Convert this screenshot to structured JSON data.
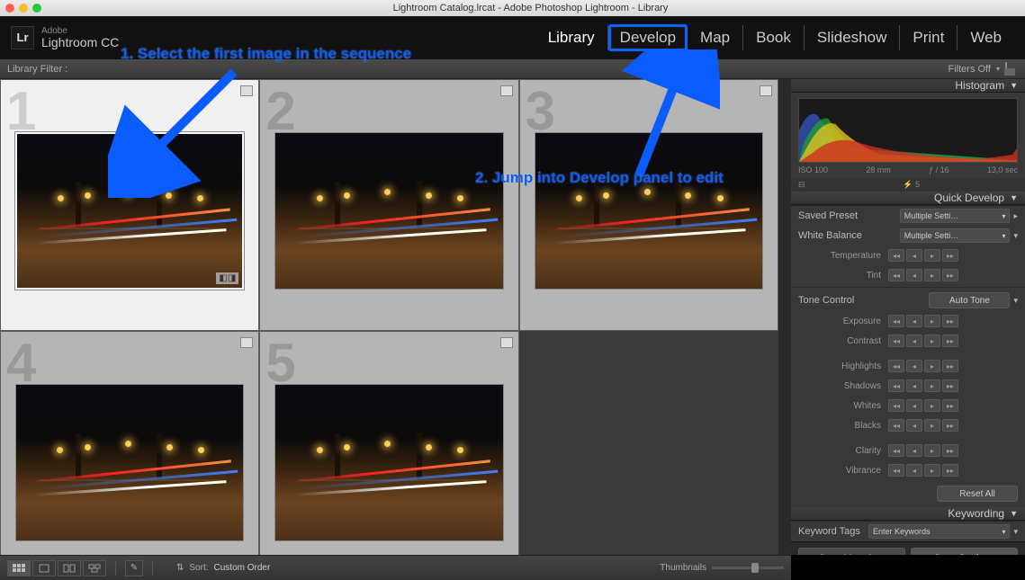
{
  "window": {
    "title": "Lightroom Catalog.lrcat - Adobe Photoshop Lightroom - Library"
  },
  "logo": {
    "abbr": "Lr",
    "line1": "Adobe",
    "line2": "Lightroom CC"
  },
  "modules": {
    "library": "Library",
    "develop": "Develop",
    "map": "Map",
    "book": "Book",
    "slideshow": "Slideshow",
    "print": "Print",
    "web": "Web"
  },
  "filterbar": {
    "label": "Library Filter :",
    "filters_off": "Filters Off"
  },
  "thumbs": {
    "count": 5,
    "selected": 1
  },
  "histogram": {
    "title": "Histogram",
    "iso": "ISO 100",
    "focal": "28 mm",
    "aperture": "ƒ / 16",
    "shutter": "13,0 sec",
    "flash": "5"
  },
  "quickdev": {
    "title": "Quick Develop",
    "saved_preset_lbl": "Saved Preset",
    "saved_preset_val": "Multiple Setti…",
    "wb_lbl": "White Balance",
    "wb_val": "Multiple Setti…",
    "temp": "Temperature",
    "tint": "Tint",
    "tone_lbl": "Tone Control",
    "auto_tone": "Auto Tone",
    "exposure": "Exposure",
    "contrast": "Contrast",
    "highlights": "Highlights",
    "shadows": "Shadows",
    "whites": "Whites",
    "blacks": "Blacks",
    "clarity": "Clarity",
    "vibrance": "Vibrance",
    "reset": "Reset All"
  },
  "keywording": {
    "title": "Keywording",
    "tags_lbl": "Keyword Tags",
    "enter": "Enter Keywords"
  },
  "sync": {
    "meta": "Sync Metadata",
    "settings": "Sync Settings"
  },
  "bottom": {
    "sort_lbl": "Sort:",
    "sort_val": "Custom Order",
    "thumbs_lbl": "Thumbnails"
  },
  "annotations": {
    "a1": "1. Select the first image in the sequence",
    "a2": "2. Jump into Develop panel to edit"
  }
}
